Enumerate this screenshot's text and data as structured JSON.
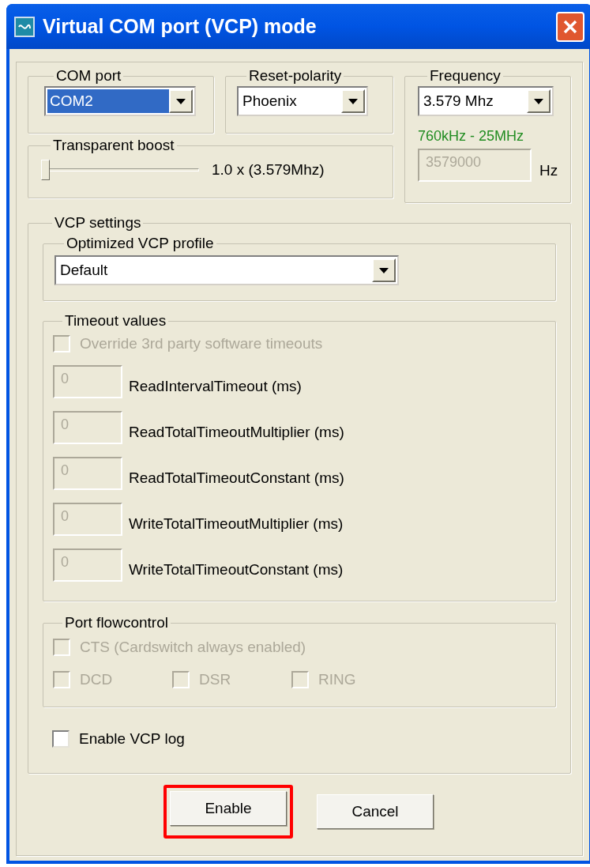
{
  "window": {
    "title": "Virtual COM port (VCP) mode"
  },
  "com_port": {
    "label": "COM port",
    "value": "COM2",
    "focused": true
  },
  "reset_polarity": {
    "label": "Reset-polarity",
    "value": "Phoenix",
    "focused": false
  },
  "frequency": {
    "label": "Frequency",
    "value": "3.579 Mhz",
    "focused": false,
    "range": "760kHz - 25MHz",
    "hz_value": "3579000",
    "hz_disabled": true,
    "unit": "Hz"
  },
  "transparent_boost": {
    "label": "Transparent boost",
    "level": 0,
    "reading": "1.0 x (3.579Mhz)"
  },
  "vcp_settings": {
    "label": "VCP settings",
    "profile": {
      "label": "Optimized VCP profile",
      "value": "Default",
      "focused": false
    },
    "timeouts": {
      "label": "Timeout values",
      "override": {
        "label": "Override 3rd party software timeouts",
        "checked": false,
        "disabled": true
      },
      "fields": [
        {
          "value": "0",
          "label": "ReadIntervalTimeout (ms)",
          "disabled": true
        },
        {
          "value": "0",
          "label": "ReadTotalTimeoutMultiplier (ms)",
          "disabled": true
        },
        {
          "value": "0",
          "label": "ReadTotalTimeoutConstant (ms)",
          "disabled": true
        },
        {
          "value": "0",
          "label": "WriteTotalTimeoutMultiplier (ms)",
          "disabled": true
        },
        {
          "value": "0",
          "label": "WriteTotalTimeoutConstant (ms)",
          "disabled": true
        }
      ]
    },
    "flowcontrol": {
      "label": "Port flowcontrol",
      "rows": [
        {
          "items": [
            {
              "label": "CTS (Cardswitch always enabled)",
              "checked": false,
              "disabled": true
            }
          ]
        },
        {
          "items": [
            {
              "label": "DCD",
              "checked": false,
              "disabled": true
            },
            {
              "label": "DSR",
              "checked": false,
              "disabled": true
            },
            {
              "label": "RING",
              "checked": false,
              "disabled": true
            }
          ]
        }
      ]
    },
    "log": {
      "label": "Enable VCP log",
      "checked": false,
      "disabled": false
    }
  },
  "buttons": [
    {
      "label": "Enable",
      "highlighted": true
    },
    {
      "label": "Cancel",
      "highlighted": false
    }
  ]
}
